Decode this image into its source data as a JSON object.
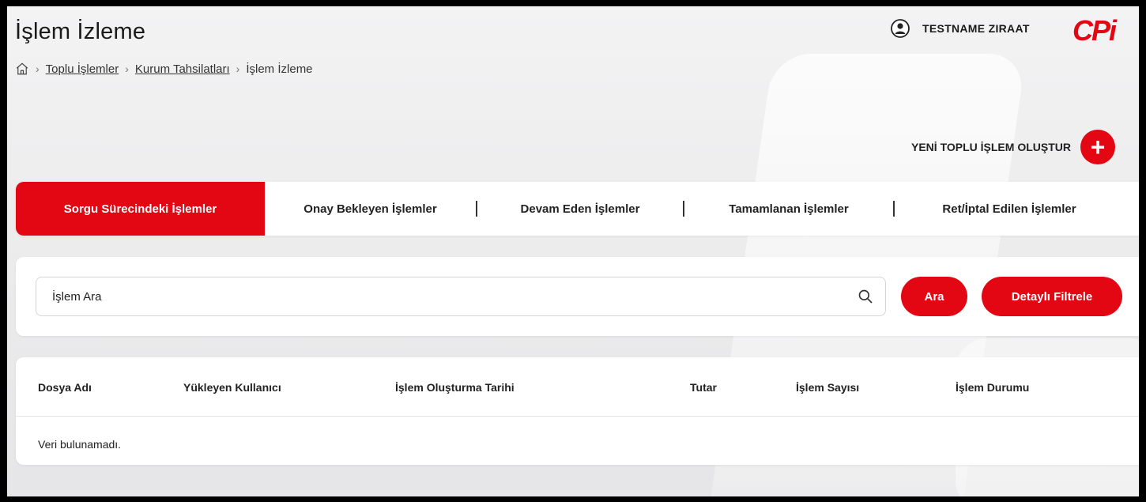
{
  "header": {
    "title": "İşlem İzleme",
    "breadcrumb": [
      "Toplu İşlemler",
      "Kurum Tahsilatları",
      "İşlem İzleme"
    ],
    "user_name": "TESTNAME ZIRAAT",
    "logo_text": "CPi"
  },
  "actions": {
    "new_bulk_label": "YENİ TOPLU İŞLEM OLUŞTUR",
    "new_bulk_icon": "plus-icon"
  },
  "tabs": [
    {
      "label": "Sorgu Sürecindeki İşlemler",
      "active": true
    },
    {
      "label": "Onay Bekleyen İşlemler",
      "active": false
    },
    {
      "label": "Devam Eden İşlemler",
      "active": false
    },
    {
      "label": "Tamamlanan İşlemler",
      "active": false
    },
    {
      "label": "Ret/İptal Edilen İşlemler",
      "active": false
    }
  ],
  "search": {
    "placeholder": "İşlem Ara",
    "search_button": "Ara",
    "filter_button": "Detaylı Filtrele"
  },
  "table": {
    "columns": [
      "Dosya Adı",
      "Yükleyen Kullanıcı",
      "İşlem Oluşturma Tarihi",
      "Tutar",
      "İşlem Sayısı",
      "İşlem Durumu"
    ],
    "empty_message": "Veri bulunamadı."
  },
  "colors": {
    "accent": "#e30613",
    "background": "#ececed",
    "card": "#ffffff"
  }
}
